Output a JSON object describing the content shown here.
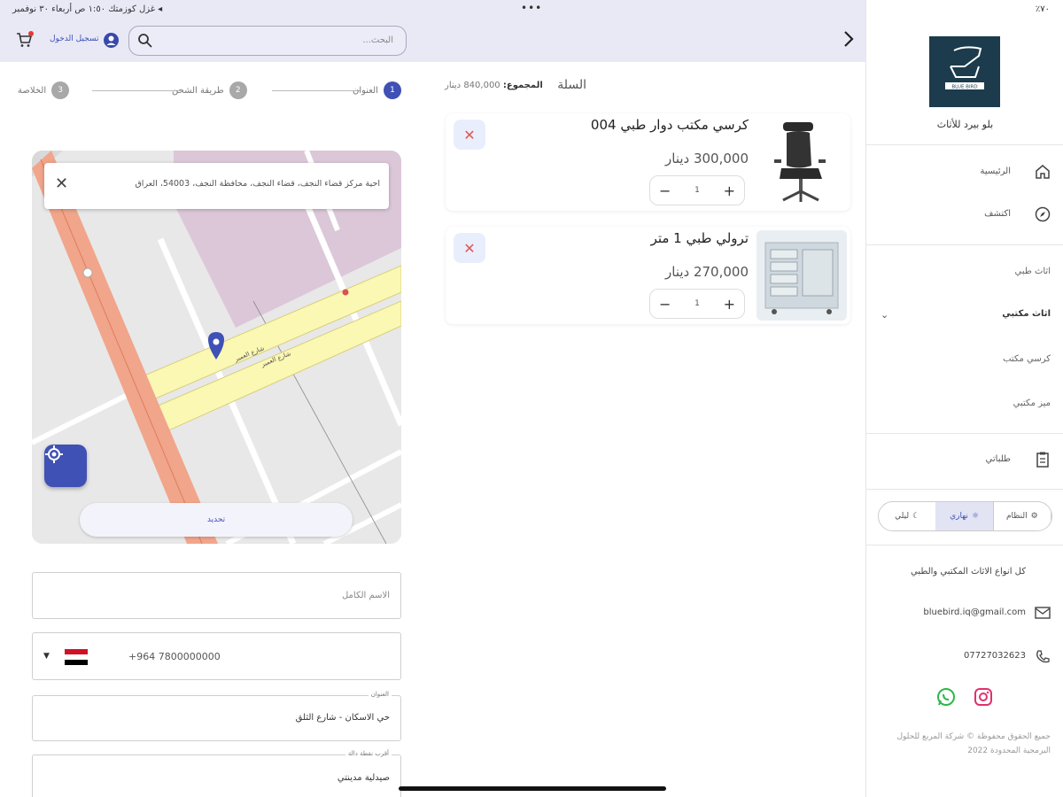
{
  "status_bar": {
    "left_text": "◂ غزل كوزمتك   ١:٥٠ ص   أربعاء ٣٠ نوفمبر",
    "dots": "•••",
    "right_text": "٪٧٠"
  },
  "topbar": {
    "search_placeholder": "البحث...",
    "login_label": "تسجيل الدخول"
  },
  "stepper": {
    "steps": [
      {
        "num": "1",
        "label": "العنوان"
      },
      {
        "num": "2",
        "label": "طريقة الشحن"
      },
      {
        "num": "3",
        "label": "الخلاصة"
      }
    ]
  },
  "map": {
    "address_text": "احية مركز قضاء النجف، قضاء النجف، محافظة النجف، 54003، العراق",
    "confirm_label": "تحديد",
    "labels": [
      "شارع العمير",
      "شارع العمير"
    ]
  },
  "form": {
    "name_placeholder": "الاسم الكامل",
    "phone_value": "+964 7800000000",
    "address_label": "العنوان",
    "address_value": "حي الاسكان - شارع الثلق",
    "landmark_label": "أقرب نقطة دالة",
    "landmark_value": "صيدلية مدينتي"
  },
  "cart": {
    "title": "السلة",
    "total_label": "المجموع:",
    "total_value": "840,000 دينار",
    "items": [
      {
        "name": "كرسي مكتب دوار طبي 004",
        "price": "300,000 دينار",
        "qty": "1"
      },
      {
        "name": "ترولي طبي 1 متر",
        "price": "270,000 دينار",
        "qty": "1"
      }
    ]
  },
  "sidebar": {
    "logo_text": "BLUE BIRD",
    "brand": "بلو بيرد للأثاث",
    "nav": [
      {
        "label": "الرئيسية",
        "icon": "home-icon"
      },
      {
        "label": "اكتشف",
        "icon": "compass-icon"
      }
    ],
    "categories": [
      {
        "label": "اثاث طبي"
      },
      {
        "label": "اثاث مكتبي"
      },
      {
        "label": "كرسي مكتب"
      },
      {
        "label": "ميز مكتبي"
      }
    ],
    "orders_label": "طلباتي",
    "theme": {
      "system": "النظام",
      "light": "نهاري",
      "dark": "ليلي"
    },
    "tagline": "كل انواع الاثاث المكتبي والطبي",
    "email": "bluebird.iq@gmail.com",
    "phone": "07727032623",
    "copyright": "جميع الحقوق محفوظة © شركة المربع للحلول البرمجية المحدودة 2022"
  },
  "colors": {
    "accent": "#3f51b5",
    "topbar_bg": "#e9e9f6",
    "remove": "#e25555"
  }
}
